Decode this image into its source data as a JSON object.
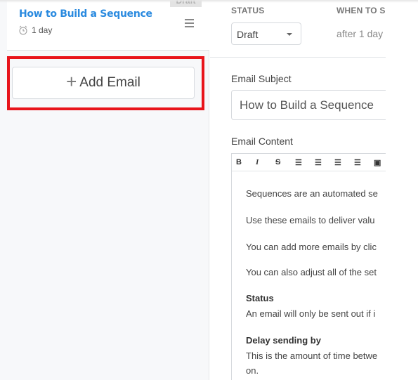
{
  "sequence_card": {
    "title": "How to Build a Sequence",
    "delay": "1 day",
    "status_badge": "Draft"
  },
  "add_email_label": "Add Email",
  "details": {
    "status_label": "STATUS",
    "status_value": "Draft",
    "when_label": "WHEN TO S",
    "when_value": "after 1 day"
  },
  "subject": {
    "label": "Email Subject",
    "value": "How to Build a Sequence"
  },
  "content": {
    "label": "Email Content",
    "toolbar": [
      "B",
      "I",
      "S",
      "ul",
      "ol",
      "outdent",
      "indent",
      "image"
    ],
    "lines": [
      "Sequences are an automated se",
      "Use these emails to deliver valu",
      "You can add more emails by clic",
      "You can also adjust all of the set"
    ],
    "status_heading": "Status",
    "status_text": "An email will only be sent out if i",
    "delay_heading": "Delay sending by",
    "delay_text": "This is the amount of time betwe",
    "delay_text2": "on."
  },
  "colors": {
    "accent": "#2a8adf",
    "highlight": "#e8141b"
  }
}
